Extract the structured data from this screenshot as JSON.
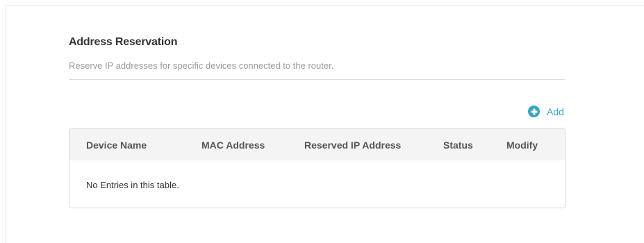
{
  "section": {
    "title": "Address Reservation",
    "description": "Reserve IP addresses for specific devices connected to the router."
  },
  "toolbar": {
    "add_label": "Add",
    "add_icon": "plus-circle-icon",
    "accent_color": "#35a5c5"
  },
  "table": {
    "columns": [
      "Device Name",
      "MAC Address",
      "Reserved IP Address",
      "Status",
      "Modify"
    ],
    "rows": [],
    "empty_text": "No Entries in this table."
  }
}
